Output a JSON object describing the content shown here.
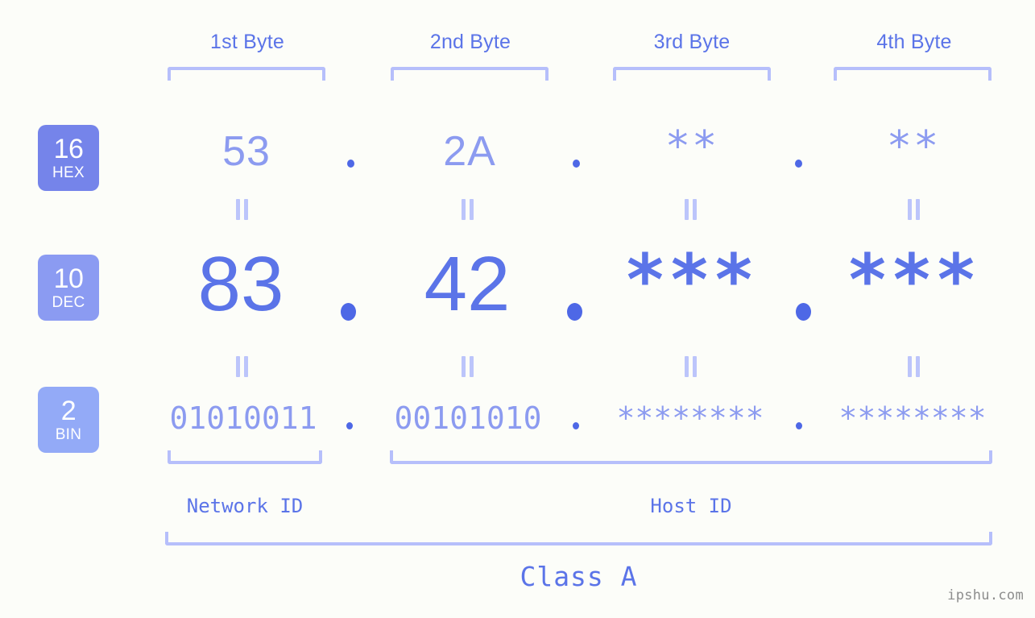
{
  "diagram": {
    "background_color": "#fcfdf9",
    "accent_color": "#5b74e8",
    "light_accent_color": "#8c9bf0",
    "bracket_color": "#b6bffb"
  },
  "byte_headers": [
    {
      "label": "1st Byte"
    },
    {
      "label": "2nd Byte"
    },
    {
      "label": "3rd Byte"
    },
    {
      "label": "4th Byte"
    }
  ],
  "bases": [
    {
      "number": "16",
      "name": "HEX",
      "color": "#7584ea"
    },
    {
      "number": "10",
      "name": "DEC",
      "color": "#8b9bf2"
    },
    {
      "number": "2",
      "name": "BIN",
      "color": "#93aaf7"
    }
  ],
  "rows": {
    "hex": {
      "values": [
        "53",
        "2A",
        "**",
        "**"
      ]
    },
    "dec": {
      "values": [
        "83",
        "42",
        "***",
        "***"
      ]
    },
    "bin": {
      "values": [
        "01010011",
        "00101010",
        "********",
        "********"
      ]
    }
  },
  "separators": {
    "hex": [
      ".",
      ".",
      "."
    ],
    "dec": [
      ".",
      ".",
      "."
    ],
    "bin": [
      ".",
      ".",
      "."
    ]
  },
  "equality_marks": {
    "symbol": "="
  },
  "regions": [
    {
      "label": "Network ID"
    },
    {
      "label": "Host ID"
    }
  ],
  "class": {
    "label": "Class A"
  },
  "watermark": {
    "text": "ipshu.com"
  }
}
